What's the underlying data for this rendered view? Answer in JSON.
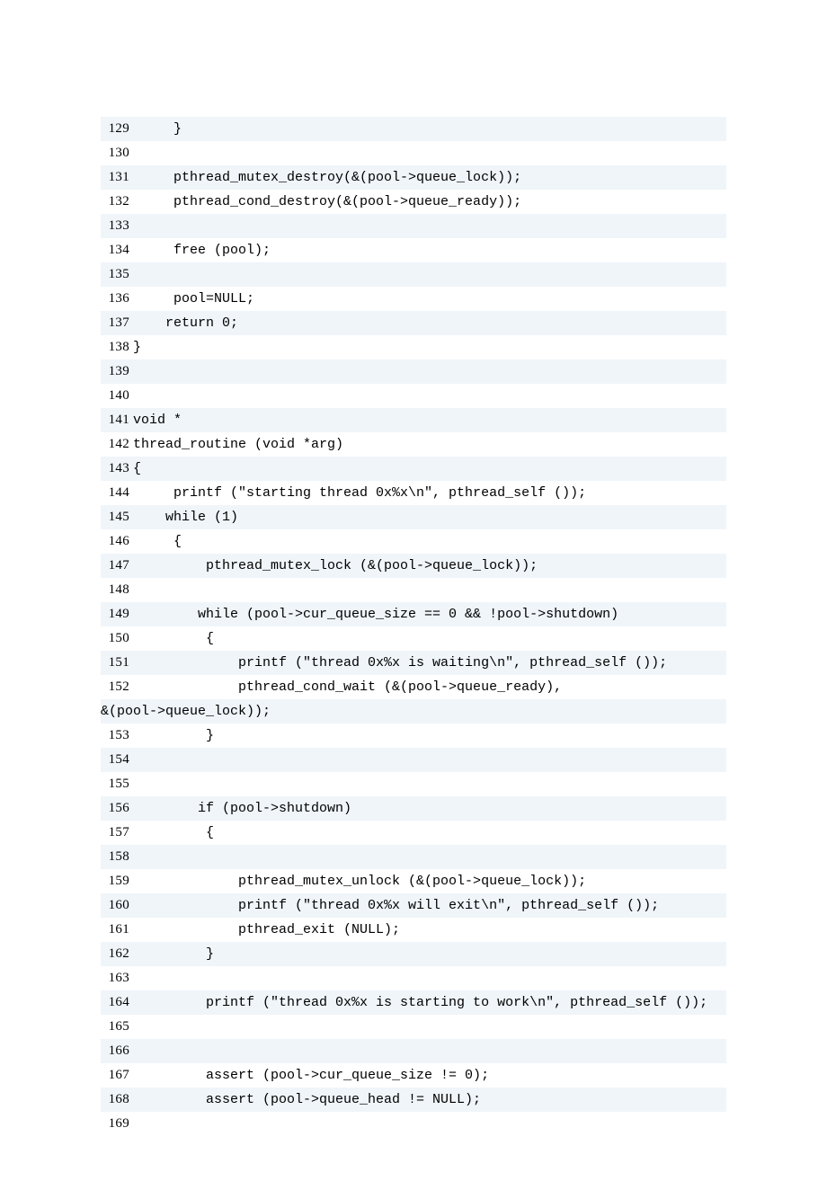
{
  "lines": [
    {
      "num": "129",
      "code": "     }  "
    },
    {
      "num": "130",
      "code": " "
    },
    {
      "num": "131",
      "code": "     pthread_mutex_destroy(&(pool->queue_lock));  "
    },
    {
      "num": "132",
      "code": "     pthread_cond_destroy(&(pool->queue_ready));  "
    },
    {
      "num": "133",
      "code": "       "
    },
    {
      "num": "134",
      "code": "     free (pool);  "
    },
    {
      "num": "135",
      "code": "      "
    },
    {
      "num": "136",
      "code": "     pool=NULL;  "
    },
    {
      "num": "137",
      "code": "    return 0;  "
    },
    {
      "num": "138",
      "code": "}  "
    },
    {
      "num": "139",
      "code": " "
    },
    {
      "num": "140",
      "code": " "
    },
    {
      "num": "141",
      "code": "void *  "
    },
    {
      "num": "142",
      "code": "thread_routine (void *arg)  "
    },
    {
      "num": "143",
      "code": "{  "
    },
    {
      "num": "144",
      "code": "     printf (\"starting thread 0x%x\\n\", pthread_self ());  "
    },
    {
      "num": "145",
      "code": "    while (1)  "
    },
    {
      "num": "146",
      "code": "     {  "
    },
    {
      "num": "147",
      "code": "         pthread_mutex_lock (&(pool->queue_lock));  "
    },
    {
      "num": "148",
      "code": "    "
    },
    {
      "num": "149",
      "code": "        while (pool->cur_queue_size == 0 && !pool->shutdown)  "
    },
    {
      "num": "150",
      "code": "         {  "
    },
    {
      "num": "151",
      "code": "             printf (\"thread 0x%x is waiting\\n\", pthread_self ());  "
    },
    {
      "num": "152",
      "code": "             pthread_cond_wait (&(pool->queue_ready), &(pool->queue_lock));  "
    },
    {
      "num": "153",
      "code": "         }  "
    },
    {
      "num": "154",
      "code": " "
    },
    {
      "num": "155",
      "code": "          "
    },
    {
      "num": "156",
      "code": "        if (pool->shutdown)  "
    },
    {
      "num": "157",
      "code": "         {  "
    },
    {
      "num": "158",
      "code": "              "
    },
    {
      "num": "159",
      "code": "             pthread_mutex_unlock (&(pool->queue_lock));  "
    },
    {
      "num": "160",
      "code": "             printf (\"thread 0x%x will exit\\n\", pthread_self ());  "
    },
    {
      "num": "161",
      "code": "             pthread_exit (NULL);  "
    },
    {
      "num": "162",
      "code": "         }  "
    },
    {
      "num": "163",
      "code": " "
    },
    {
      "num": "164",
      "code": "         printf (\"thread 0x%x is starting to work\\n\", pthread_self ());"
    },
    {
      "num": "165",
      "code": " "
    },
    {
      "num": "166",
      "code": "          "
    },
    {
      "num": "167",
      "code": "         assert (pool->cur_queue_size != 0);  "
    },
    {
      "num": "168",
      "code": "         assert (pool->queue_head != NULL);  "
    },
    {
      "num": "169",
      "code": "           "
    }
  ],
  "wrap_index": 23,
  "max_inner_width": 692
}
